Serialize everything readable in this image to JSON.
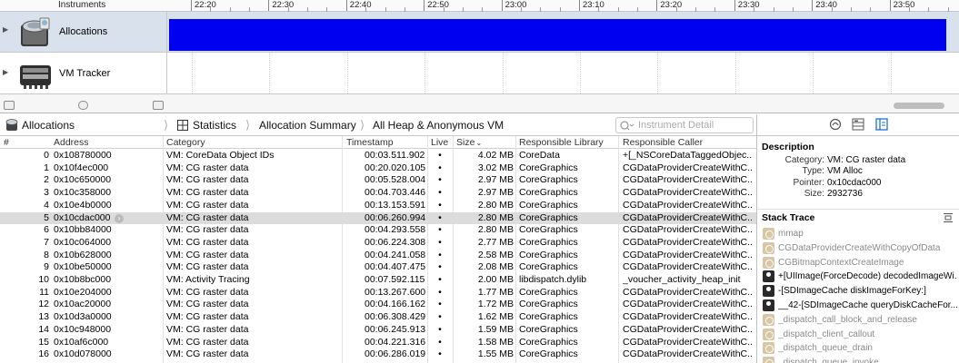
{
  "timeline": {
    "header_title": "Instruments",
    "ruler_ticks": [
      "22:20",
      "22:30",
      "22:40",
      "22:50",
      "23:00",
      "23:10",
      "23:20",
      "23:30",
      "23:40",
      "23:50"
    ],
    "tracks": [
      {
        "name": "Allocations",
        "icon": "allocations-instrument-icon"
      },
      {
        "name": "VM Tracker",
        "icon": "vm-tracker-instrument-icon"
      }
    ]
  },
  "jumpbar": {
    "instrument": "Allocations",
    "view": "Statistics",
    "summary": "Allocation Summary",
    "filter": "All Heap & Anonymous VM",
    "detail_placeholder": "Instrument Detail"
  },
  "table": {
    "headers": {
      "index": "#",
      "address": "Address",
      "category": "Category",
      "timestamp": "Timestamp",
      "live": "Live",
      "size": "Size",
      "library": "Responsible Library",
      "caller": "Responsible Caller"
    },
    "selected_row": 5,
    "rows": [
      {
        "index": "0",
        "address": "0x108780000",
        "category": "VM: CoreData Object IDs",
        "timestamp": "00:03.511.902",
        "live": "•",
        "size": "4.02 MB",
        "library": "CoreData",
        "caller": "+[_NSCoreDataTaggedObjec..."
      },
      {
        "index": "1",
        "address": "0x10f4ec000",
        "category": "VM: CG raster data",
        "timestamp": "00:20.020.105",
        "live": "•",
        "size": "3.02 MB",
        "library": "CoreGraphics",
        "caller": "CGDataProviderCreateWithC..."
      },
      {
        "index": "2",
        "address": "0x10c650000",
        "category": "VM: CG raster data",
        "timestamp": "00:05.528.004",
        "live": "•",
        "size": "2.97 MB",
        "library": "CoreGraphics",
        "caller": "CGDataProviderCreateWithC..."
      },
      {
        "index": "3",
        "address": "0x10c358000",
        "category": "VM: CG raster data",
        "timestamp": "00:04.703.446",
        "live": "•",
        "size": "2.97 MB",
        "library": "CoreGraphics",
        "caller": "CGDataProviderCreateWithC..."
      },
      {
        "index": "4",
        "address": "0x10e4b0000",
        "category": "VM: CG raster data",
        "timestamp": "00:13.153.591",
        "live": "•",
        "size": "2.80 MB",
        "library": "CoreGraphics",
        "caller": "CGDataProviderCreateWithC..."
      },
      {
        "index": "5",
        "address": "0x10cdac000",
        "category": "VM: CG raster data",
        "timestamp": "00:06.260.994",
        "live": "•",
        "size": "2.80 MB",
        "library": "CoreGraphics",
        "caller": "CGDataProviderCreateWithC..."
      },
      {
        "index": "6",
        "address": "0x10bb84000",
        "category": "VM: CG raster data",
        "timestamp": "00:04.293.558",
        "live": "•",
        "size": "2.80 MB",
        "library": "CoreGraphics",
        "caller": "CGDataProviderCreateWithC..."
      },
      {
        "index": "7",
        "address": "0x10c064000",
        "category": "VM: CG raster data",
        "timestamp": "00:06.224.308",
        "live": "•",
        "size": "2.77 MB",
        "library": "CoreGraphics",
        "caller": "CGDataProviderCreateWithC..."
      },
      {
        "index": "8",
        "address": "0x10b628000",
        "category": "VM: CG raster data",
        "timestamp": "00:04.241.058",
        "live": "•",
        "size": "2.58 MB",
        "library": "CoreGraphics",
        "caller": "CGDataProviderCreateWithC..."
      },
      {
        "index": "9",
        "address": "0x10be50000",
        "category": "VM: CG raster data",
        "timestamp": "00:04.407.475",
        "live": "•",
        "size": "2.08 MB",
        "library": "CoreGraphics",
        "caller": "CGDataProviderCreateWithC..."
      },
      {
        "index": "10",
        "address": "0x10b8bc000",
        "category": "VM: Activity Tracing",
        "timestamp": "00:07.592.115",
        "live": "•",
        "size": "2.00 MB",
        "library": "libdispatch.dylib",
        "caller": "_voucher_activity_heap_init"
      },
      {
        "index": "11",
        "address": "0x10e204000",
        "category": "VM: CG raster data",
        "timestamp": "00:13.267.600",
        "live": "•",
        "size": "1.77 MB",
        "library": "CoreGraphics",
        "caller": "CGDataProviderCreateWithC..."
      },
      {
        "index": "12",
        "address": "0x10ac20000",
        "category": "VM: CG raster data",
        "timestamp": "00:04.166.162",
        "live": "•",
        "size": "1.72 MB",
        "library": "CoreGraphics",
        "caller": "CGDataProviderCreateWithC..."
      },
      {
        "index": "13",
        "address": "0x10d3a0000",
        "category": "VM: CG raster data",
        "timestamp": "00:06.308.429",
        "live": "•",
        "size": "1.62 MB",
        "library": "CoreGraphics",
        "caller": "CGDataProviderCreateWithC..."
      },
      {
        "index": "14",
        "address": "0x10c948000",
        "category": "VM: CG raster data",
        "timestamp": "00:06.245.913",
        "live": "•",
        "size": "1.59 MB",
        "library": "CoreGraphics",
        "caller": "CGDataProviderCreateWithC..."
      },
      {
        "index": "15",
        "address": "0x10af6c000",
        "category": "VM: CG raster data",
        "timestamp": "00:04.221.316",
        "live": "•",
        "size": "1.58 MB",
        "library": "CoreGraphics",
        "caller": "CGDataProviderCreateWithC..."
      },
      {
        "index": "16",
        "address": "0x10d078000",
        "category": "VM: CG raster data",
        "timestamp": "00:06.286.019",
        "live": "•",
        "size": "1.55 MB",
        "library": "CoreGraphics",
        "caller": "CGDataProviderCreateWithC..."
      }
    ]
  },
  "inspector": {
    "description_title": "Description",
    "description": [
      {
        "key": "Category:",
        "value": "VM: CG raster data"
      },
      {
        "key": "Type:",
        "value": "VM Alloc"
      },
      {
        "key": "Pointer:",
        "value": "0x10cdac000"
      },
      {
        "key": "Size:",
        "value": "2932736"
      }
    ],
    "stack_title": "Stack Trace",
    "stack": [
      {
        "label": "mmap",
        "kind": "system"
      },
      {
        "label": "CGDataProviderCreateWithCopyOfData",
        "kind": "system"
      },
      {
        "label": "CGBitmapContextCreateImage",
        "kind": "system"
      },
      {
        "label": "+[UIImage(ForceDecode) decodedImageWi...",
        "kind": "user"
      },
      {
        "label": "-[SDImageCache diskImageForKey:]",
        "kind": "user"
      },
      {
        "label": "__42-[SDImageCache queryDiskCacheFor...",
        "kind": "user"
      },
      {
        "label": "_dispatch_call_block_and_release",
        "kind": "system"
      },
      {
        "label": "_dispatch_client_callout",
        "kind": "system"
      },
      {
        "label": "_dispatch_queue_drain",
        "kind": "system"
      },
      {
        "label": "_dispatch_queue_invoke",
        "kind": "system"
      }
    ]
  },
  "colors": {
    "allocation_graph": "#0000f0",
    "selected_track": "#d9e1ec",
    "selected_row": "#dcdcdc"
  }
}
